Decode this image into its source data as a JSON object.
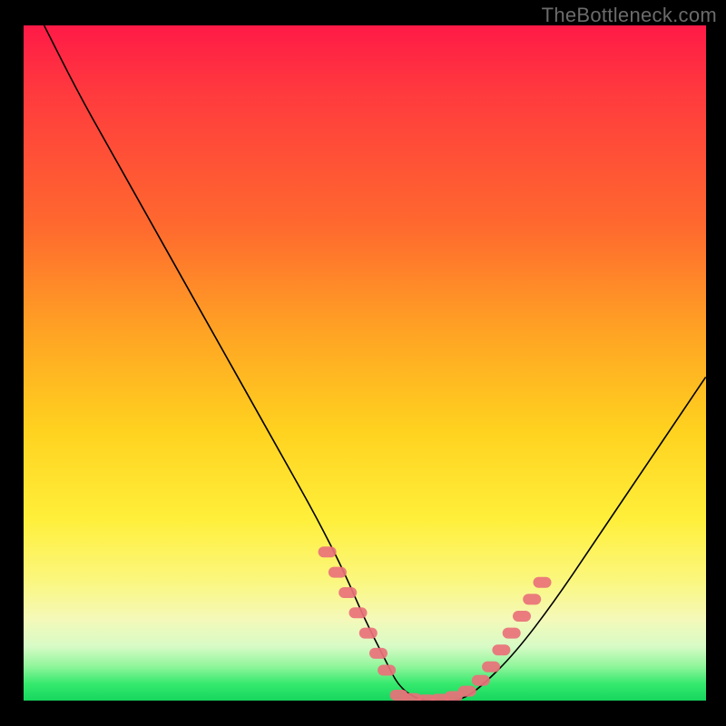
{
  "watermark": "TheBottleneck.com",
  "colors": {
    "background": "#000000",
    "marker": "#e9717a",
    "curve": "#000000",
    "gradient_top": "#ff1a47",
    "gradient_bottom": "#16d65e"
  },
  "chart_data": {
    "type": "line",
    "title": "",
    "xlabel": "",
    "ylabel": "",
    "xlim": [
      0,
      100
    ],
    "ylim": [
      0,
      100
    ],
    "notes": "V-shaped bottleneck curve. y roughly represents bottleneck percentage (100 at top, 0 at bottom). No axis ticks or numeric labels are rendered in the image; x/y values are normalized 0–100 estimates read from pixel positions. Highlighted segments (markers) flag portions of the curve near the trough where the curve enters the pale/green band.",
    "series": [
      {
        "name": "bottleneck-curve",
        "x": [
          3,
          8,
          13,
          18,
          23,
          28,
          33,
          38,
          43,
          47,
          50,
          53,
          55,
          58,
          61,
          64,
          67,
          72,
          78,
          84,
          90,
          96,
          100
        ],
        "y": [
          100,
          90,
          81,
          72,
          63,
          54,
          45,
          36,
          27,
          19,
          12,
          6,
          2,
          0,
          0,
          0,
          2,
          7,
          15,
          24,
          33,
          42,
          48
        ]
      }
    ],
    "highlighted_segments": [
      {
        "name": "left-descent-markers",
        "x": [
          44.5,
          46.0,
          47.5,
          49.0,
          50.5,
          52.0,
          53.2
        ],
        "y": [
          22.0,
          19.0,
          16.0,
          13.0,
          10.0,
          7.0,
          4.5
        ]
      },
      {
        "name": "valley-floor-markers",
        "x": [
          55.0,
          57.0,
          59.0,
          61.0,
          63.0,
          65.0
        ],
        "y": [
          0.8,
          0.3,
          0.1,
          0.2,
          0.6,
          1.4
        ]
      },
      {
        "name": "right-ascent-markers",
        "x": [
          67.0,
          68.5,
          70.0,
          71.5,
          73.0,
          74.5,
          76.0
        ],
        "y": [
          3.0,
          5.0,
          7.5,
          10.0,
          12.5,
          15.0,
          17.5
        ]
      }
    ]
  }
}
